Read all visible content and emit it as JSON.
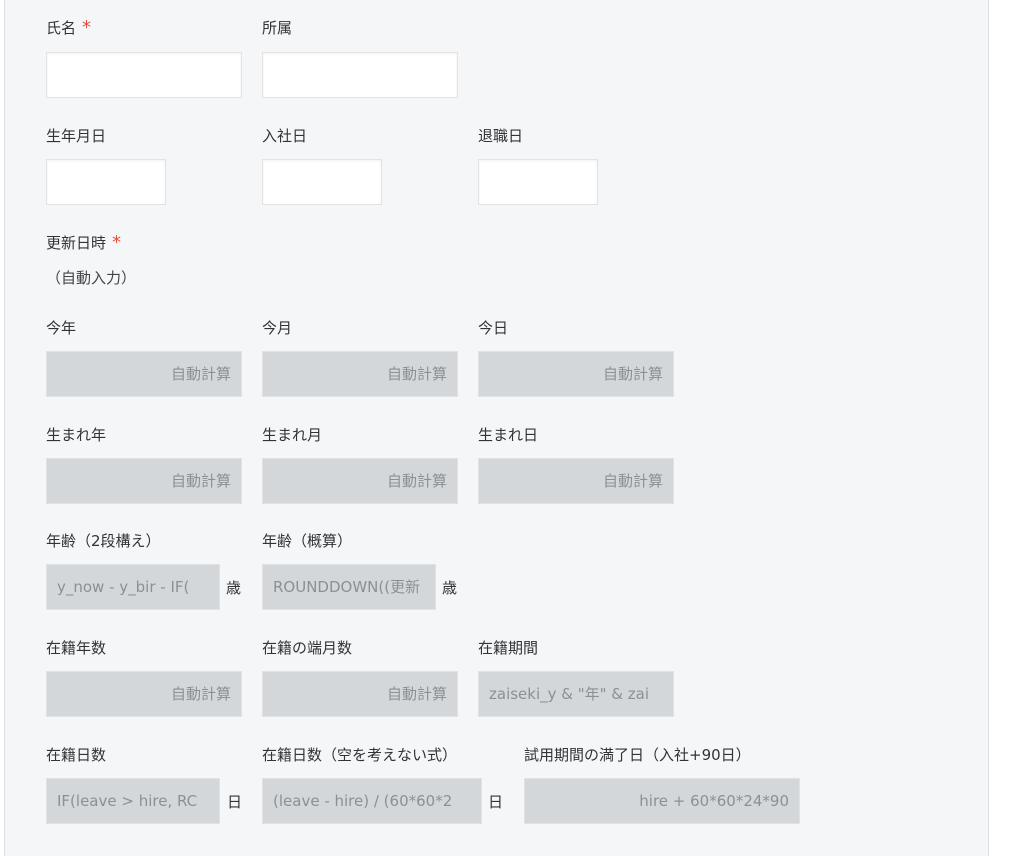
{
  "fields": {
    "name": {
      "label": "氏名",
      "required_mark": "*"
    },
    "dept": {
      "label": "所属"
    },
    "birth": {
      "label": "生年月日"
    },
    "hire": {
      "label": "入社日"
    },
    "leave": {
      "label": "退職日"
    },
    "updated": {
      "label": "更新日時",
      "required_mark": "*",
      "value": "（自動入力）"
    },
    "this_year": {
      "label": "今年",
      "value": "自動計算"
    },
    "this_month": {
      "label": "今月",
      "value": "自動計算"
    },
    "today": {
      "label": "今日",
      "value": "自動計算"
    },
    "birth_year": {
      "label": "生まれ年",
      "value": "自動計算"
    },
    "birth_month": {
      "label": "生まれ月",
      "value": "自動計算"
    },
    "birth_day": {
      "label": "生まれ日",
      "value": "自動計算"
    },
    "age_two_step": {
      "label": "年齢（2段構え）",
      "value": "y_now - y_bir - IF(",
      "unit": "歳"
    },
    "age_approx": {
      "label": "年齢（概算）",
      "value": "ROUNDDOWN((更新",
      "unit": "歳"
    },
    "tenure_years": {
      "label": "在籍年数",
      "value": "自動計算"
    },
    "tenure_months": {
      "label": "在籍の端月数",
      "value": "自動計算"
    },
    "tenure_period": {
      "label": "在籍期間",
      "value": "zaiseki_y & \"年\" & zai"
    },
    "tenure_days": {
      "label": "在籍日数",
      "value": "IF(leave > hire, RC",
      "unit": "日"
    },
    "tenure_days_simple": {
      "label": "在籍日数（空を考えない式）",
      "value": "(leave - hire) / (60*60*2",
      "unit": "日"
    },
    "probation_end": {
      "label": "試用期間の満了日（入社+90日）",
      "value": "hire + 60*60*24*90"
    }
  },
  "colors": {
    "required": "#e74c3c",
    "calc_bg": "#d4d7d9",
    "panel_bg": "#f5f6f8"
  }
}
